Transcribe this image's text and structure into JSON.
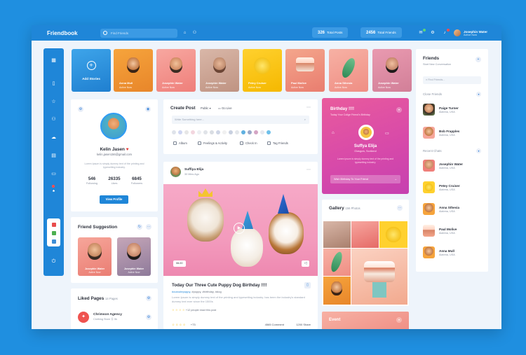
{
  "topbar": {
    "logo": "Friendbook",
    "search_placeholder": "Find Friends",
    "total_posts_value": "326",
    "total_posts_label": "Total Posts",
    "total_friends_value": "2456",
    "total_friends_label": "Total Friends",
    "user_name": "Josephin Water",
    "user_status": "Active Now"
  },
  "stories": [
    {
      "name": "Add Stories",
      "status": ""
    },
    {
      "name": "Anna Mull",
      "status": "Active Now"
    },
    {
      "name": "Josephin Water",
      "status": "Active Now"
    },
    {
      "name": "Josephin Water",
      "status": "Active Now"
    },
    {
      "name": "Petey Cruiser",
      "status": "Active Now"
    },
    {
      "name": "Paul Molive",
      "status": "Active Now"
    },
    {
      "name": "Anna Sthesia",
      "status": "Active Now"
    },
    {
      "name": "Josephin Water",
      "status": "Active Now"
    }
  ],
  "profile": {
    "name": "Kelin Jasen",
    "email": "kelin.jasen156@gmail.com",
    "description": "Lorem Ipsum is simply dummy text of the printing and typesetting industry.",
    "following_value": "546",
    "following_label": "Following",
    "likes_value": "26335",
    "likes_label": "Likes",
    "followers_value": "6845",
    "followers_label": "Followers",
    "button": "View Profile"
  },
  "suggestion": {
    "title": "Friend Suggestion",
    "items": [
      {
        "name": "Josephin Water",
        "status": "Active Now"
      },
      {
        "name": "Josephin Water",
        "status": "Active Now"
      }
    ]
  },
  "liked_pages": {
    "title": "Liked Pages",
    "count": "14 Pages",
    "page_name": "Chrimson Agency",
    "page_meta": "Clothing Store",
    "page_extra": "Ⓢ 5k"
  },
  "create_post": {
    "title": "Create Post",
    "visibility": "Public",
    "go_live": "Go Live",
    "placeholder": "Write Something here...",
    "actions": [
      "Album",
      "Feelings & Activity",
      "Check In",
      "Tag Friends"
    ]
  },
  "post": {
    "author": "Suffiya Elija",
    "time": "30 Mins Ago",
    "duration": "06:20",
    "title": "Today Our Three Cute Puppy Dog Birthday !!!!",
    "tags_primary": "#ourcutepuppy,",
    "tags_rest": " #puppy, #birthday, #dog",
    "body": "Lorem Ipsum is simply dummy text of the printing and typesetting industry. has been the industry's standard dummy text ever since the 1500s",
    "read": "+12 people react this post",
    "comments": "4565 Comment",
    "shares": "1200 Share"
  },
  "birthday": {
    "title": "Birthday !!!!",
    "subtitle": "Today Your Collge Friend's Birthday",
    "name": "Suffya Elija",
    "location": "Glasgow, Scotland",
    "description": "Lorem Ipsum is simply dummy text of the printing and typesetting industry.",
    "cta": "Wish Birthday To Your Friend"
  },
  "gallery": {
    "title": "Gallery",
    "count": "156 Photos"
  },
  "event": {
    "title": "Event"
  },
  "friends": {
    "title": "Friends",
    "subtitle": "Start New Conversation",
    "search_placeholder": "Find Friends...",
    "close_label": "Close Friends",
    "recent_label": "Recent Chats",
    "close": [
      {
        "name": "Paige Turner",
        "address": "Alabma, USA"
      },
      {
        "name": "Bob Frapples",
        "address": "Alabma, USA"
      }
    ],
    "recent": [
      {
        "name": "Josephin Water",
        "address": "Alabma, USA"
      },
      {
        "name": "Petey Cruiser",
        "address": "Alabma, USA"
      },
      {
        "name": "Anna Sthesia",
        "address": "Alabma, USA"
      },
      {
        "name": "Paul Molive",
        "address": "Alabma, USA"
      },
      {
        "name": "Anna Mull",
        "address": "Alabma, USA"
      }
    ]
  },
  "colors": {
    "brand": "#1f86d8",
    "accent_pink": "#d84aa9",
    "background": "#1f8fe0"
  }
}
